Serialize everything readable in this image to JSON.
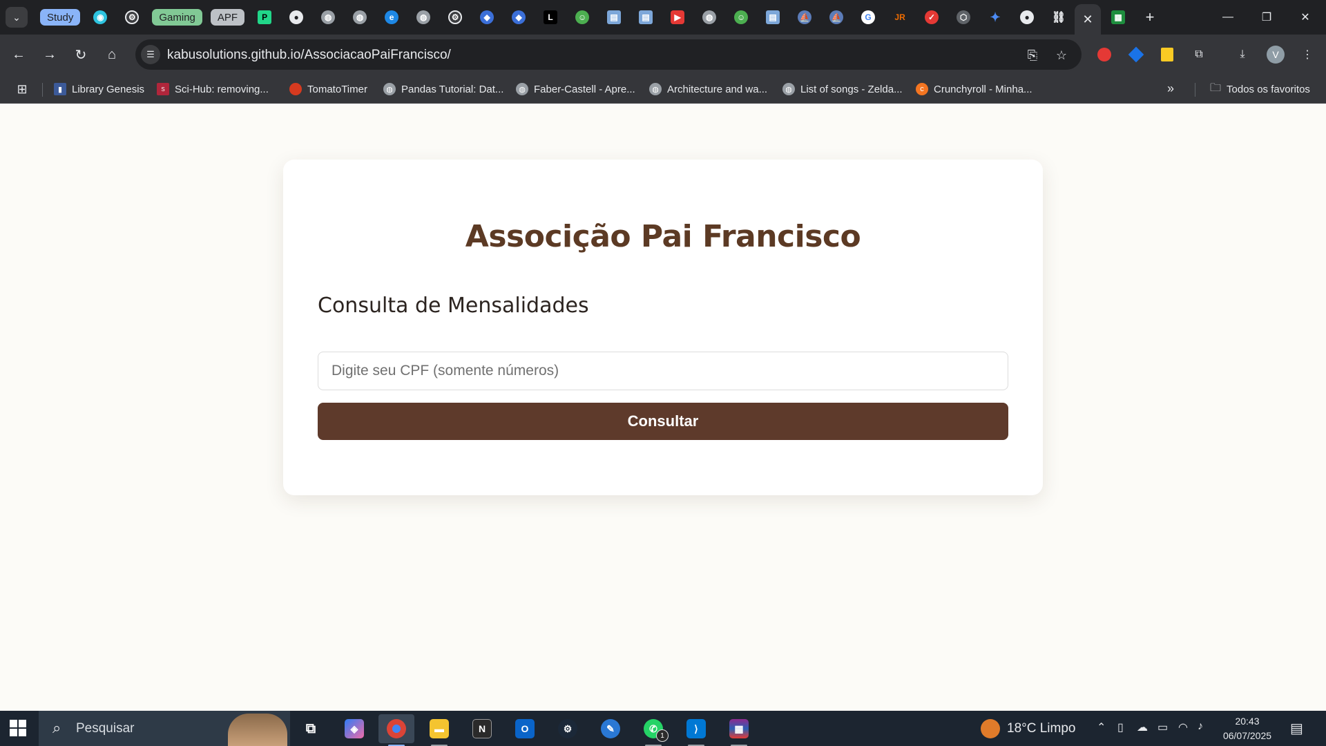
{
  "browser": {
    "tab_groups": [
      {
        "label": "Study",
        "color": "#8ab4f8"
      },
      {
        "label": "Gaming",
        "color": "#81c995"
      },
      {
        "label": "APF",
        "color": "#bdc1c6"
      }
    ],
    "active_tab_close": "✕",
    "new_tab": "+",
    "window_controls": {
      "minimize": "—",
      "maximize": "❐",
      "close": "✕"
    },
    "nav": {
      "back": "←",
      "forward": "→",
      "reload": "↻",
      "home": "⌂"
    },
    "url": "kabusolutions.github.io/AssociacaoPaiFrancisco/",
    "profile_initial": "V",
    "bookmarks": [
      {
        "label": "Library Genesis",
        "icon": "book-icon"
      },
      {
        "label": "Sci-Hub: removing...",
        "icon": "scihub-icon"
      },
      {
        "label": "TomatoTimer",
        "icon": "tomato-icon"
      },
      {
        "label": "Pandas Tutorial: Dat...",
        "icon": "globe-icon"
      },
      {
        "label": "Faber-Castell - Apre...",
        "icon": "globe-icon"
      },
      {
        "label": "Architecture and wa...",
        "icon": "globe-icon"
      },
      {
        "label": "List of songs - Zelda...",
        "icon": "globe-icon"
      },
      {
        "label": "Crunchyroll - Minha...",
        "icon": "crunchyroll-icon"
      }
    ],
    "bookmarks_more": "»",
    "all_bookmarks": "Todos os favoritos"
  },
  "page": {
    "title": "Associção Pai Francisco",
    "subtitle": "Consulta de Mensalidades",
    "cpf_placeholder": "Digite seu CPF (somente números)",
    "cpf_value": "",
    "submit_label": "Consultar",
    "colors": {
      "title": "#5c3a24",
      "button": "#5e3a2b",
      "background": "#fcfbf7"
    }
  },
  "taskbar": {
    "search_placeholder": "Pesquisar",
    "weather": "18°C  Limpo",
    "time": "20:43",
    "date": "06/07/2025",
    "whatsapp_badge": "1"
  }
}
